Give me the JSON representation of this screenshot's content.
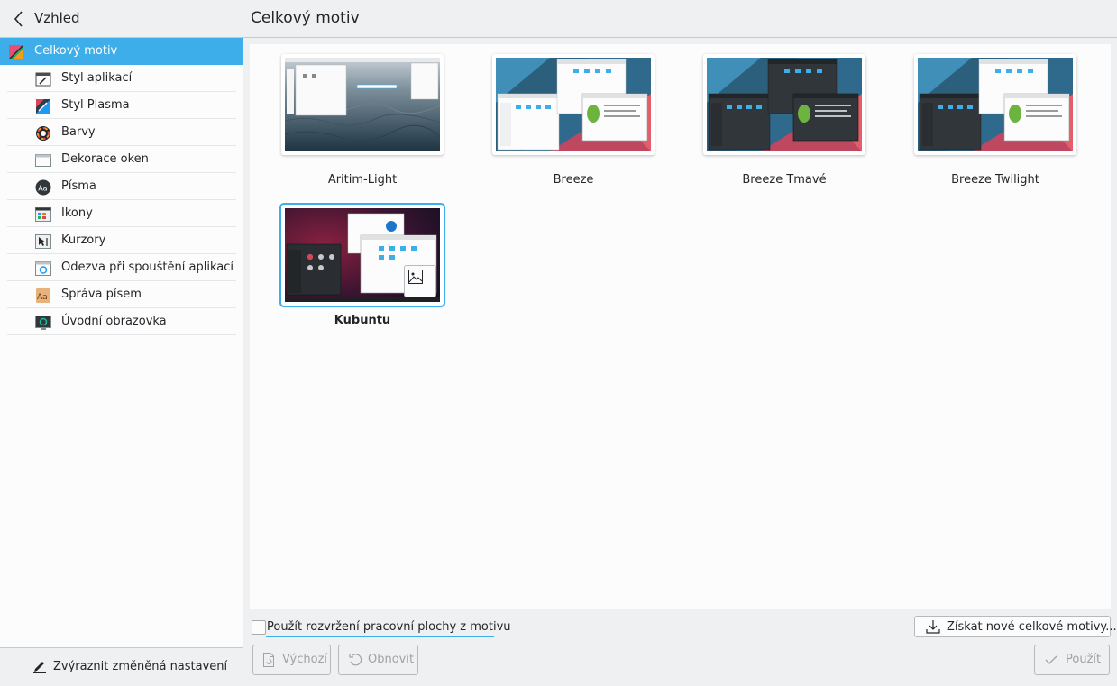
{
  "sidebar": {
    "back_label": "Vzhled",
    "items": [
      {
        "label": "Celkový motiv",
        "icon": "global-theme-icon",
        "selected": true
      },
      {
        "label": "Styl aplikací",
        "icon": "application-style-icon"
      },
      {
        "label": "Styl Plasma",
        "icon": "plasma-style-icon"
      },
      {
        "label": "Barvy",
        "icon": "colors-icon"
      },
      {
        "label": "Dekorace oken",
        "icon": "window-decorations-icon"
      },
      {
        "label": "Písma",
        "icon": "fonts-icon"
      },
      {
        "label": "Ikony",
        "icon": "icons-icon"
      },
      {
        "label": "Kurzory",
        "icon": "cursors-icon"
      },
      {
        "label": "Odezva při spouštění aplikací",
        "icon": "launch-feedback-icon"
      },
      {
        "label": "Správa písem",
        "icon": "font-management-icon"
      },
      {
        "label": "Úvodní obrazovka",
        "icon": "splash-screen-icon"
      }
    ],
    "footer_label": "Zvýraznit změněná nastavení"
  },
  "main": {
    "title": "Celkový motiv",
    "themes": [
      {
        "name": "Aritim-Light"
      },
      {
        "name": "Breeze"
      },
      {
        "name": "Breeze Tmavé"
      },
      {
        "name": "Breeze Twilight"
      },
      {
        "name": "Kubuntu",
        "selected": true
      }
    ],
    "use_layout_checkbox": {
      "label": "Použít rozvržení pracovní plochy z motivu",
      "checked": false
    },
    "get_new_label": "Získat nové celkové motivy...",
    "defaults_label": "Výchozí",
    "reset_label": "Obnovit",
    "apply_label": "Použít"
  },
  "colors": {
    "accent": "#3daee9",
    "window": "#eff0f1",
    "view": "#fcfcfc"
  }
}
